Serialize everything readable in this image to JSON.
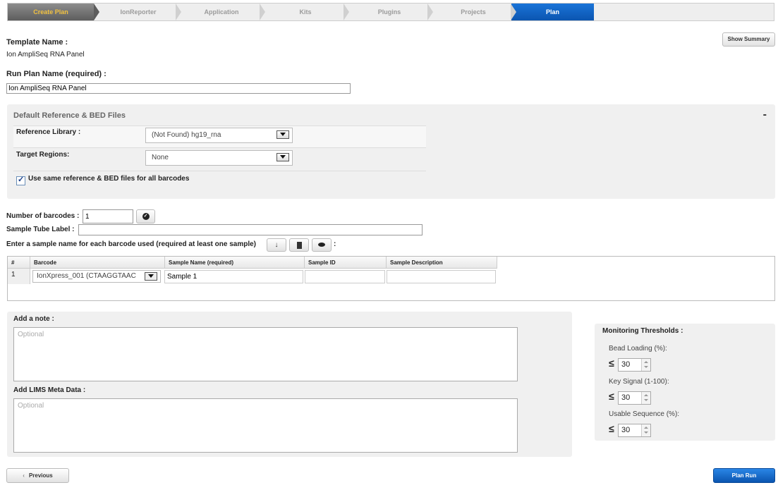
{
  "wizard": {
    "steps": [
      "Create Plan",
      "IonReporter",
      "Application",
      "Kits",
      "Plugins",
      "Projects",
      "Plan"
    ],
    "active": "Plan"
  },
  "header": {
    "show_summary": "Show Summary",
    "template_name_label": "Template Name :",
    "template_name_value": "Ion AmpliSeq RNA Panel",
    "run_plan_label": "Run Plan Name (required) :",
    "run_plan_value": "Ion AmpliSeq RNA Panel"
  },
  "reference": {
    "title": "Default Reference & BED Files",
    "collapse": "-",
    "reference_library_label": "Reference Library :",
    "reference_library_value": "(Not Found) hg19_rna",
    "target_regions_label": "Target Regions:",
    "target_regions_value": "None",
    "same_files_label": "Use same reference & BED files for all barcodes",
    "same_files_checked": true
  },
  "barcodes": {
    "number_label": "Number of barcodes :",
    "number_value": "1",
    "tube_label": "Sample Tube Label :",
    "tube_value": "",
    "instruction": "Enter a sample name for each barcode used (required at least one sample)",
    "instruction_suffix": ":",
    "columns": [
      "#",
      "Barcode",
      "Sample Name (required)",
      "Sample ID",
      "Sample Description"
    ],
    "rows": [
      {
        "num": "1",
        "barcode": "IonXpress_001 (CTAAGGTAAC",
        "sample_name": "Sample 1",
        "sample_id": "",
        "sample_description": ""
      }
    ]
  },
  "notes": {
    "note_label": "Add a note :",
    "note_placeholder": "Optional",
    "lims_label": "Add LIMS Meta Data :",
    "lims_placeholder": "Optional"
  },
  "thresholds": {
    "title": "Monitoring Thresholds :",
    "le_symbol": "≤",
    "bead_loading_label": "Bead Loading (%):",
    "bead_loading_value": "30",
    "key_signal_label": "Key Signal (1-100):",
    "key_signal_value": "30",
    "usable_sequence_label": "Usable Sequence (%):",
    "usable_sequence_value": "30"
  },
  "footer": {
    "previous": "Previous",
    "previous_icon": "‹",
    "plan_run": "Plan Run"
  },
  "colors": {
    "active_step": "#0b55b0",
    "create_plan_text": "#f0c040",
    "primary_button": "#1a6fd0"
  }
}
